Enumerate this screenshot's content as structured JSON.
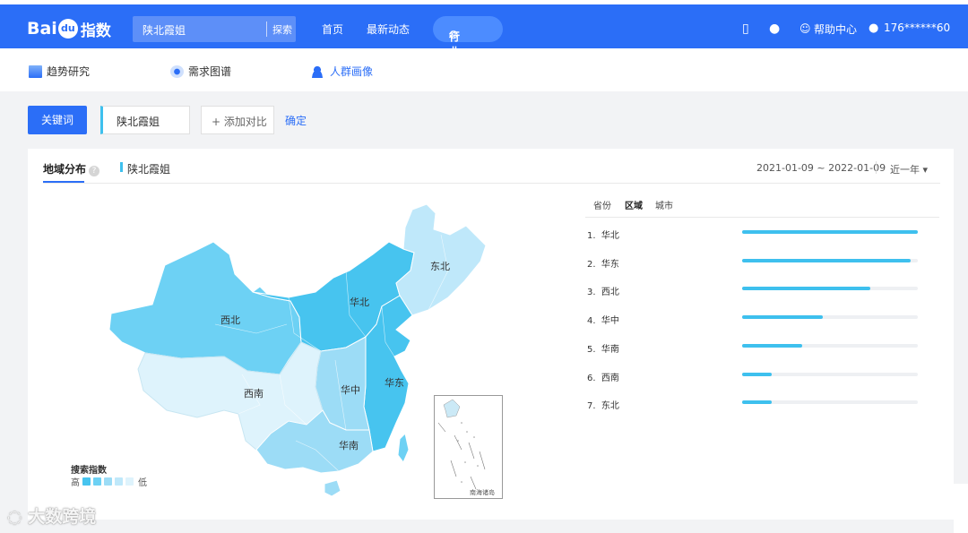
{
  "header": {
    "logo_latin": "Bai",
    "logo_paw": "du",
    "logo_zh": "指数",
    "search_value": "陕北霞姐",
    "search_button": "探索",
    "nav": [
      "首页",
      "最新动态"
    ],
    "highlight": "行业排行",
    "help": "帮助中心",
    "user": "176******60"
  },
  "subnav": {
    "items": [
      "趋势研究",
      "需求图谱",
      "人群画像"
    ]
  },
  "keyword": {
    "type_button": "关键词",
    "term": "陕北霞姐",
    "add_compare": "+ 添加对比",
    "confirm": "确定"
  },
  "panel": {
    "tab": "地域分布",
    "help_mark": "?",
    "legend_term": "陕北霞姐",
    "date_range": "2021-01-09 ~ 2022-01-09",
    "period": "近一年 ▾"
  },
  "map": {
    "labels": [
      "东北",
      "华北",
      "西北",
      "华中",
      "华东",
      "西南",
      "华南"
    ],
    "legend_title": "搜索指数",
    "legend_high": "高",
    "legend_low": "低",
    "inset_label": "南海诸岛",
    "colors": {
      "level1": "#47c4ef",
      "level2": "#6dd1f4",
      "level3": "#9cdcf6",
      "level4": "#bfe8fa",
      "level5": "#def3fc"
    }
  },
  "ranking": {
    "tabs": [
      "省份",
      "区域",
      "城市"
    ],
    "items": [
      {
        "rank": "1.",
        "name": "华北",
        "value": 1.0
      },
      {
        "rank": "2.",
        "name": "华东",
        "value": 0.96
      },
      {
        "rank": "3.",
        "name": "西北",
        "value": 0.73
      },
      {
        "rank": "4.",
        "name": "华中",
        "value": 0.46
      },
      {
        "rank": "5.",
        "name": "华南",
        "value": 0.34
      },
      {
        "rank": "6.",
        "name": "西南",
        "value": 0.17
      },
      {
        "rank": "7.",
        "name": "东北",
        "value": 0.17
      }
    ],
    "bar_color": "#3ec0ee"
  },
  "watermark": "大数跨境"
}
